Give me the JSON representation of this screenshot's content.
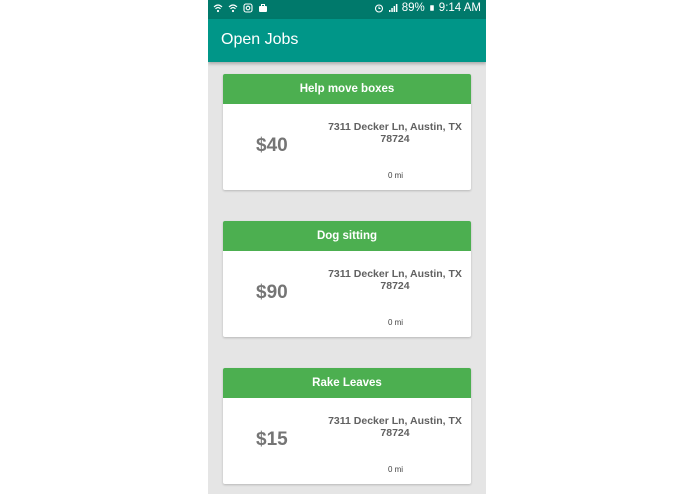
{
  "status_bar": {
    "icons_left": [
      "wifi-icon",
      "wifi-icon",
      "instagram-icon",
      "briefcase-icon"
    ],
    "icons_right": [
      "alarm-icon",
      "signal-icon",
      "battery-icon"
    ],
    "battery": "89%",
    "time": "9:14 AM"
  },
  "app_bar": {
    "title": "Open Jobs"
  },
  "jobs": [
    {
      "title": "Help move boxes",
      "price": "$40",
      "address": "7311 Decker Ln, Austin, TX 78724",
      "distance": "0 mi"
    },
    {
      "title": "Dog sitting",
      "price": "$90",
      "address": "7311 Decker Ln, Austin, TX 78724",
      "distance": "0 mi"
    },
    {
      "title": "Rake Leaves",
      "price": "$15",
      "address": "7311 Decker Ln, Austin, TX 78724",
      "distance": "0 mi"
    }
  ],
  "colors": {
    "status_bar": "#00796b",
    "app_bar": "#009688",
    "card_header": "#4caf50",
    "background": "#e5e5e5"
  }
}
